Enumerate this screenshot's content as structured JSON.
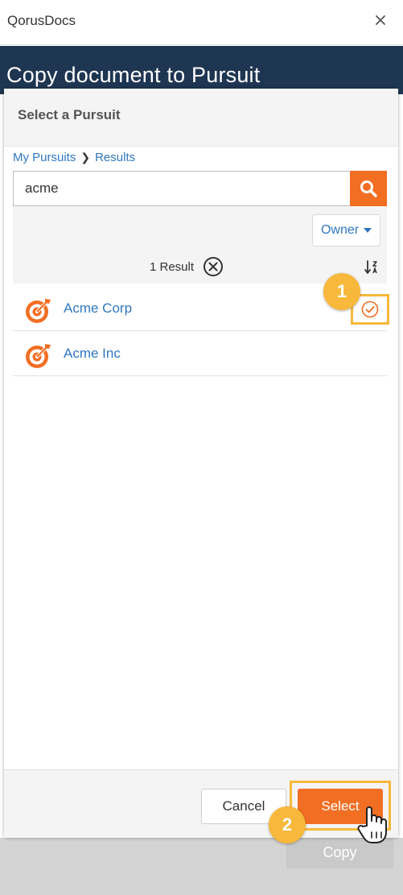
{
  "window": {
    "app_title": "QorusDocs"
  },
  "header": {
    "title": "Copy document to Pursuit"
  },
  "modal": {
    "heading": "Select a Pursuit",
    "breadcrumb": {
      "root": "My Pursuits",
      "current": "Results"
    },
    "search": {
      "value": "acme"
    },
    "filter": {
      "owner_label": "Owner",
      "result_count": "1 Result"
    },
    "results": [
      {
        "label": "Acme Corp",
        "selected": true
      },
      {
        "label": "Acme Inc",
        "selected": false
      }
    ],
    "footer": {
      "cancel_label": "Cancel",
      "select_label": "Select"
    }
  },
  "page_footer": {
    "copy_label": "Copy"
  },
  "annotations": {
    "step_1": "1",
    "step_2": "2"
  },
  "colors": {
    "accent_orange": "#f26e22",
    "header_navy": "#1f3652",
    "link_blue": "#2f77c0",
    "highlight_yellow": "#f7b83b"
  }
}
